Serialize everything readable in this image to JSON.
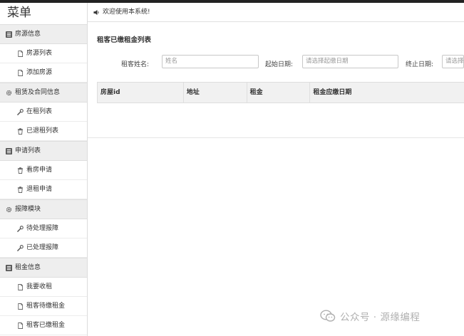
{
  "sidebar": {
    "title": "菜单",
    "groups": [
      {
        "label": "房源信息",
        "icon": "list-box-icon",
        "items": [
          {
            "label": "房源列表",
            "icon": "document-icon"
          },
          {
            "label": "添加房源",
            "icon": "document-icon"
          }
        ]
      },
      {
        "label": "租赁及合同信息",
        "icon": "gear-icon",
        "items": [
          {
            "label": "在租列表",
            "icon": "wrench-icon"
          },
          {
            "label": "已退租列表",
            "icon": "trash-icon"
          }
        ]
      },
      {
        "label": "申请列表",
        "icon": "list-box-icon",
        "items": [
          {
            "label": "看房申请",
            "icon": "trash-icon"
          },
          {
            "label": "退租申请",
            "icon": "trash-icon"
          }
        ]
      },
      {
        "label": "报障模块",
        "icon": "gear-icon",
        "items": [
          {
            "label": "待处理报障",
            "icon": "wrench-icon"
          },
          {
            "label": "已处理报障",
            "icon": "wrench-icon"
          }
        ]
      },
      {
        "label": "租金信息",
        "icon": "list-box-icon",
        "items": [
          {
            "label": "我要收租",
            "icon": "document-icon"
          },
          {
            "label": "租客待缴租金",
            "icon": "document-icon"
          },
          {
            "label": "租客已缴租金",
            "icon": "document-icon"
          }
        ]
      }
    ]
  },
  "header": {
    "welcome": "欢迎使用本系统!"
  },
  "main": {
    "heading": "租客已缴租金列表",
    "filters": {
      "name_label": "租客姓名:",
      "name_placeholder": "姓名",
      "start_label": "起始日期:",
      "start_placeholder": "请选择起缴日期",
      "end_label": "终止日期:",
      "end_placeholder": "请选择"
    },
    "table": {
      "columns": [
        "房屋id",
        "地址",
        "租金",
        "租金应缴日期"
      ]
    }
  },
  "watermark": {
    "text": "公众号 · 源缘编程"
  }
}
